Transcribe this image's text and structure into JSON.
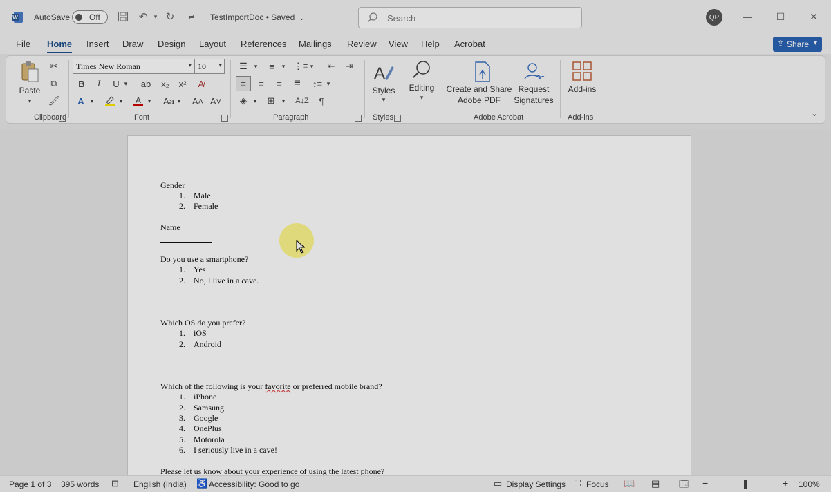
{
  "titlebar": {
    "autosave_label": "AutoSave",
    "autosave_state": "Off",
    "doc_title": "TestImportDoc • Saved",
    "search_placeholder": "Search",
    "avatar_initials": "QP"
  },
  "menu": {
    "tabs": [
      "File",
      "Home",
      "Insert",
      "Draw",
      "Design",
      "Layout",
      "References",
      "Mailings",
      "Review",
      "View",
      "Help",
      "Acrobat"
    ],
    "active": "Home",
    "share_label": "Share"
  },
  "ribbon": {
    "paste_label": "Paste",
    "font_name": "Times New Roman",
    "font_size": "10",
    "styles_label": "Styles",
    "editing_label": "Editing",
    "create_share_label_1": "Create and Share",
    "create_share_label_2": "Adobe PDF",
    "request_label_1": "Request",
    "request_label_2": "Signatures",
    "addins_label": "Add-ins",
    "groups": {
      "clipboard": "Clipboard",
      "font": "Font",
      "paragraph": "Paragraph",
      "styles": "Styles",
      "adobe": "Adobe Acrobat",
      "addins": "Add-ins"
    }
  },
  "document": {
    "q_gender": "Gender",
    "gender_options": [
      "Male",
      "Female"
    ],
    "q_name": "Name",
    "q_smartphone": "Do you use a smartphone?",
    "smartphone_options": [
      "Yes",
      "No, I live in a cave."
    ],
    "q_os": "Which OS do you prefer?",
    "os_options": [
      "iOS",
      "Android"
    ],
    "q_brand_pre": "Which of the following is your ",
    "q_brand_word": "favorite",
    "q_brand_post": " or preferred mobile brand?",
    "brand_options": [
      "iPhone",
      "Samsung",
      "Google",
      "OnePlus",
      "Motorola",
      "I seriously live in a cave!"
    ],
    "q_experience": "Please let us know about your experience of using the latest phone?"
  },
  "status": {
    "page": "Page 1 of 3",
    "words": "395 words",
    "language": "English (India)",
    "accessibility": "Accessibility: Good to go",
    "display_settings": "Display Settings",
    "focus": "Focus",
    "zoom": "100%"
  }
}
